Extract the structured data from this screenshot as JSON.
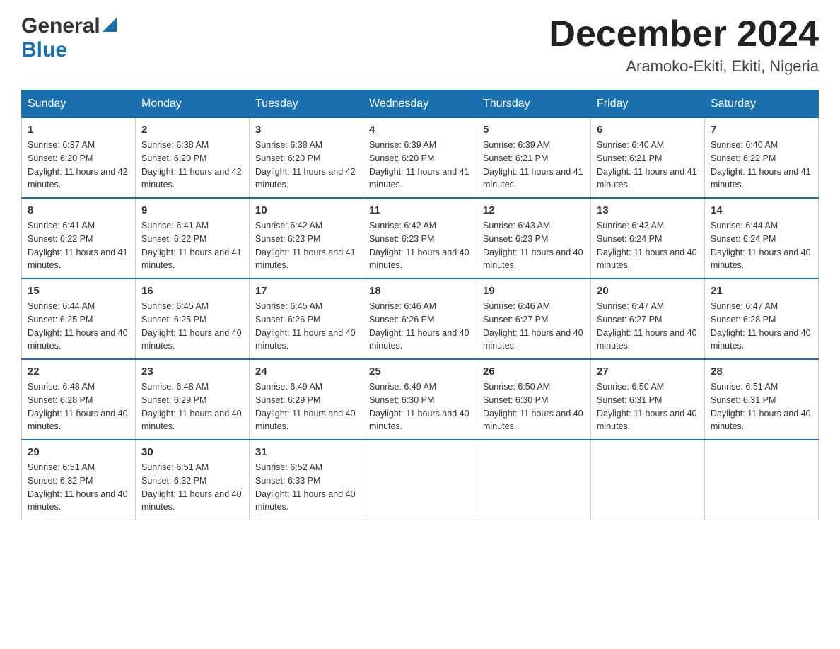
{
  "logo": {
    "general": "General",
    "blue": "Blue"
  },
  "title": {
    "month_year": "December 2024",
    "location": "Aramoko-Ekiti, Ekiti, Nigeria"
  },
  "weekdays": [
    "Sunday",
    "Monday",
    "Tuesday",
    "Wednesday",
    "Thursday",
    "Friday",
    "Saturday"
  ],
  "weeks": [
    [
      {
        "day": "1",
        "sunrise": "6:37 AM",
        "sunset": "6:20 PM",
        "daylight": "11 hours and 42 minutes."
      },
      {
        "day": "2",
        "sunrise": "6:38 AM",
        "sunset": "6:20 PM",
        "daylight": "11 hours and 42 minutes."
      },
      {
        "day": "3",
        "sunrise": "6:38 AM",
        "sunset": "6:20 PM",
        "daylight": "11 hours and 42 minutes."
      },
      {
        "day": "4",
        "sunrise": "6:39 AM",
        "sunset": "6:20 PM",
        "daylight": "11 hours and 41 minutes."
      },
      {
        "day": "5",
        "sunrise": "6:39 AM",
        "sunset": "6:21 PM",
        "daylight": "11 hours and 41 minutes."
      },
      {
        "day": "6",
        "sunrise": "6:40 AM",
        "sunset": "6:21 PM",
        "daylight": "11 hours and 41 minutes."
      },
      {
        "day": "7",
        "sunrise": "6:40 AM",
        "sunset": "6:22 PM",
        "daylight": "11 hours and 41 minutes."
      }
    ],
    [
      {
        "day": "8",
        "sunrise": "6:41 AM",
        "sunset": "6:22 PM",
        "daylight": "11 hours and 41 minutes."
      },
      {
        "day": "9",
        "sunrise": "6:41 AM",
        "sunset": "6:22 PM",
        "daylight": "11 hours and 41 minutes."
      },
      {
        "day": "10",
        "sunrise": "6:42 AM",
        "sunset": "6:23 PM",
        "daylight": "11 hours and 41 minutes."
      },
      {
        "day": "11",
        "sunrise": "6:42 AM",
        "sunset": "6:23 PM",
        "daylight": "11 hours and 40 minutes."
      },
      {
        "day": "12",
        "sunrise": "6:43 AM",
        "sunset": "6:23 PM",
        "daylight": "11 hours and 40 minutes."
      },
      {
        "day": "13",
        "sunrise": "6:43 AM",
        "sunset": "6:24 PM",
        "daylight": "11 hours and 40 minutes."
      },
      {
        "day": "14",
        "sunrise": "6:44 AM",
        "sunset": "6:24 PM",
        "daylight": "11 hours and 40 minutes."
      }
    ],
    [
      {
        "day": "15",
        "sunrise": "6:44 AM",
        "sunset": "6:25 PM",
        "daylight": "11 hours and 40 minutes."
      },
      {
        "day": "16",
        "sunrise": "6:45 AM",
        "sunset": "6:25 PM",
        "daylight": "11 hours and 40 minutes."
      },
      {
        "day": "17",
        "sunrise": "6:45 AM",
        "sunset": "6:26 PM",
        "daylight": "11 hours and 40 minutes."
      },
      {
        "day": "18",
        "sunrise": "6:46 AM",
        "sunset": "6:26 PM",
        "daylight": "11 hours and 40 minutes."
      },
      {
        "day": "19",
        "sunrise": "6:46 AM",
        "sunset": "6:27 PM",
        "daylight": "11 hours and 40 minutes."
      },
      {
        "day": "20",
        "sunrise": "6:47 AM",
        "sunset": "6:27 PM",
        "daylight": "11 hours and 40 minutes."
      },
      {
        "day": "21",
        "sunrise": "6:47 AM",
        "sunset": "6:28 PM",
        "daylight": "11 hours and 40 minutes."
      }
    ],
    [
      {
        "day": "22",
        "sunrise": "6:48 AM",
        "sunset": "6:28 PM",
        "daylight": "11 hours and 40 minutes."
      },
      {
        "day": "23",
        "sunrise": "6:48 AM",
        "sunset": "6:29 PM",
        "daylight": "11 hours and 40 minutes."
      },
      {
        "day": "24",
        "sunrise": "6:49 AM",
        "sunset": "6:29 PM",
        "daylight": "11 hours and 40 minutes."
      },
      {
        "day": "25",
        "sunrise": "6:49 AM",
        "sunset": "6:30 PM",
        "daylight": "11 hours and 40 minutes."
      },
      {
        "day": "26",
        "sunrise": "6:50 AM",
        "sunset": "6:30 PM",
        "daylight": "11 hours and 40 minutes."
      },
      {
        "day": "27",
        "sunrise": "6:50 AM",
        "sunset": "6:31 PM",
        "daylight": "11 hours and 40 minutes."
      },
      {
        "day": "28",
        "sunrise": "6:51 AM",
        "sunset": "6:31 PM",
        "daylight": "11 hours and 40 minutes."
      }
    ],
    [
      {
        "day": "29",
        "sunrise": "6:51 AM",
        "sunset": "6:32 PM",
        "daylight": "11 hours and 40 minutes."
      },
      {
        "day": "30",
        "sunrise": "6:51 AM",
        "sunset": "6:32 PM",
        "daylight": "11 hours and 40 minutes."
      },
      {
        "day": "31",
        "sunrise": "6:52 AM",
        "sunset": "6:33 PM",
        "daylight": "11 hours and 40 minutes."
      },
      null,
      null,
      null,
      null
    ]
  ],
  "labels": {
    "sunrise": "Sunrise: ",
    "sunset": "Sunset: ",
    "daylight": "Daylight: "
  }
}
